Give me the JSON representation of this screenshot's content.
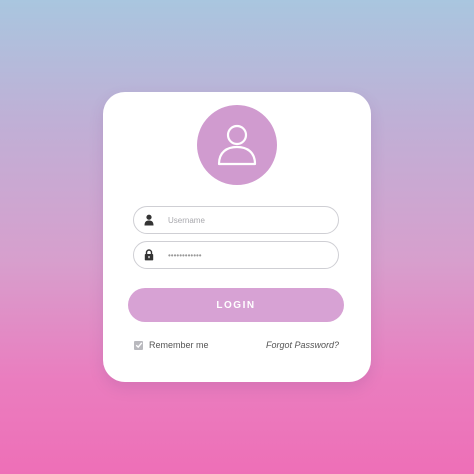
{
  "login_form": {
    "avatar_icon": "user-icon",
    "username": {
      "placeholder": "Username",
      "value": "",
      "icon": "user-icon"
    },
    "password": {
      "placeholder": "",
      "value": "••••••••••••",
      "icon": "lock-icon"
    },
    "login_button_label": "LOGIN",
    "remember_me": {
      "label": "Remember me",
      "checked": true
    },
    "forgot_password_label": "Forgot Password?"
  },
  "colors": {
    "accent": "#d7a2d4",
    "avatar_bg": "#d09bcf",
    "background_top": "#a9c6df",
    "background_bottom": "#ee6fb7"
  }
}
